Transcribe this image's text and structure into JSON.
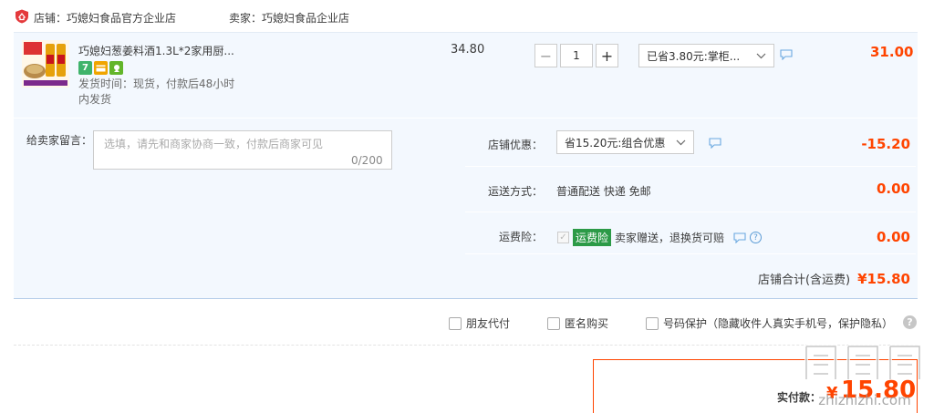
{
  "header": {
    "shop_prefix": "店铺：",
    "shop_name": "巧媳妇食品官方企业店",
    "seller_prefix": "卖家：",
    "seller_name": "巧媳妇食品企业店"
  },
  "item": {
    "title": "巧媳妇葱姜料酒1.3L*2家用厨...",
    "tags": [
      {
        "icon": "seven-day-return-icon",
        "text": "7",
        "color": "#3fb36b"
      },
      {
        "icon": "card-payment-icon",
        "text": "",
        "color": "#f0a500"
      },
      {
        "icon": "consumer-protection-icon",
        "text": "",
        "color": "#62b52a"
      }
    ],
    "ship_time": "发货时间：现货，付款后48小时内发货",
    "unit_price": "34.80",
    "quantity": "1",
    "minus": "−",
    "plus": "+",
    "discount_select": "已省3.80元:掌柜...",
    "subtotal": "31.00"
  },
  "message": {
    "label": "给卖家留言：",
    "placeholder": "选填，请先和商家协商一致，付款后商家可见",
    "counter": "0/200"
  },
  "shop_discount": {
    "label": "店铺优惠：",
    "select": "省15.20元:组合优惠",
    "amount": "-15.20"
  },
  "shipping": {
    "label": "运送方式：",
    "value": "普通配送 快递 免邮",
    "amount": "0.00"
  },
  "insurance": {
    "label": "运费险：",
    "badge": "运费险",
    "text": "卖家赠送，退换货可赔",
    "amount": "0.00"
  },
  "shop_total": {
    "label": "店铺合计(含运费)",
    "amount": "¥15.80"
  },
  "options": {
    "friend_pay": "朋友代付",
    "anonymous": "匿名购买",
    "number_protect": "号码保护（隐藏收件人真实手机号，保护隐私）"
  },
  "payment": {
    "label": "实付款：",
    "currency": "¥",
    "amount": "15.80"
  },
  "watermark": {
    "text": "zhizhizhi.com"
  },
  "colors": {
    "accent": "#ff4400",
    "panel": "#f3f8fe",
    "insurance_green": "#2c9a47",
    "logo_red": "#e4393c"
  }
}
